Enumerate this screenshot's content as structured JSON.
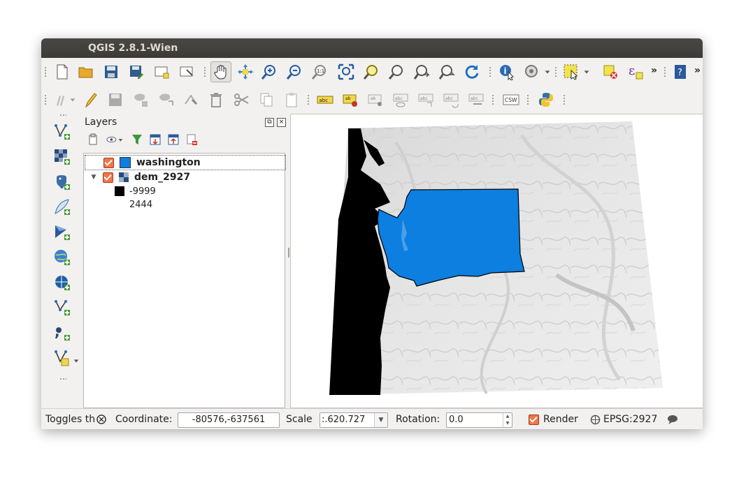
{
  "window": {
    "title": "QGIS 2.8.1-Wien"
  },
  "layers_panel": {
    "title": "Layers",
    "layers": [
      {
        "name": "washington",
        "checked": true,
        "symbol_color": "#0c7fe0"
      },
      {
        "name": "dem_2927",
        "checked": true,
        "legend": [
          {
            "label": "-9999",
            "color": "#000000"
          },
          {
            "label": "2444",
            "color": "#ffffff"
          }
        ]
      }
    ]
  },
  "status_bar": {
    "toggle_label": "Toggles th",
    "coordinate_label": "Coordinate:",
    "coordinate_value": "-80576,-637561",
    "scale_label": "Scale",
    "scale_value": ":.620.727",
    "rotation_label": "Rotation:",
    "rotation_value": "0.0",
    "render_label": "Render",
    "render_checked": true,
    "crs_label": "EPSG:2927"
  },
  "toolbar": {
    "more_label": "»"
  },
  "edit_toolbar": {
    "label_abc": "abc",
    "label_csw": "CSW"
  },
  "colors": {
    "accent_checkbox": "#f07746",
    "state_fill": "#0c7fe0",
    "titlebar": "#3c3b37"
  }
}
